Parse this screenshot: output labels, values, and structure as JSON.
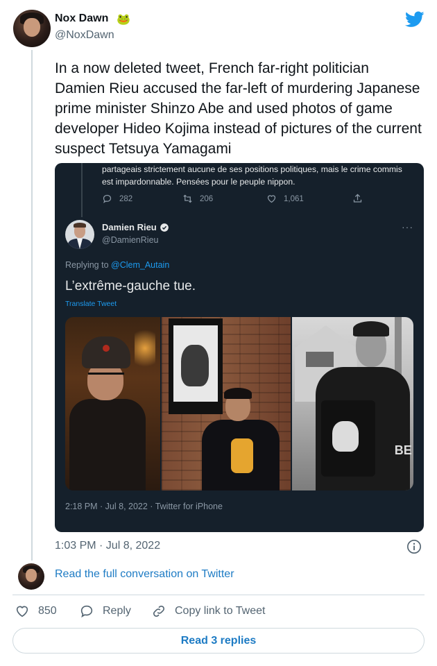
{
  "author": {
    "name": "Nox Dawn",
    "emoji": "🐸",
    "handle": "@NoxDawn"
  },
  "tweet": {
    "text": "In a now deleted tweet, French far-right politician Damien Rieu accused the far-left of murdering Japanese prime minister Shinzo Abe and used photos of game developer Hideo Kojima instead of pictures of the current suspect Tetsuya Yamagami",
    "timestamp": "1:03 PM · Jul 8, 2022"
  },
  "embedded": {
    "previous_text": "partageais strictement aucune de ses positions politiques, mais le crime commis est impardonnable. Pensées pour le peuple nippon.",
    "stats": {
      "replies": "282",
      "retweets": "206",
      "likes": "1,061"
    },
    "rieu_name": "Damien Rieu",
    "rieu_handle": "@DamienRieu",
    "replying_prefix": "Replying to ",
    "replying_to": "@Clem_Autain",
    "rieu_text": "L’extrême-gauche tue.",
    "translate": "Translate Tweet",
    "rieu_time": "2:18 PM · Jul 8, 2022 · Twitter for iPhone",
    "more": "···",
    "photo_letters": "BE"
  },
  "footer": {
    "read_convo": "Read the full conversation on Twitter",
    "like_count": "850",
    "reply_label": "Reply",
    "copy_label": "Copy link to Tweet",
    "read_replies": "Read 3 replies"
  },
  "colors": {
    "twitter_blue": "#1d9bf0",
    "link_blue": "#1d7bc4",
    "embed_bg": "#15202b",
    "muted": "#536471"
  },
  "icons": [
    "twitter-bird-icon",
    "frog-emoji",
    "reply-icon",
    "retweet-icon",
    "heart-icon",
    "share-icon",
    "verified-badge-icon",
    "more-icon",
    "info-icon",
    "link-icon"
  ]
}
